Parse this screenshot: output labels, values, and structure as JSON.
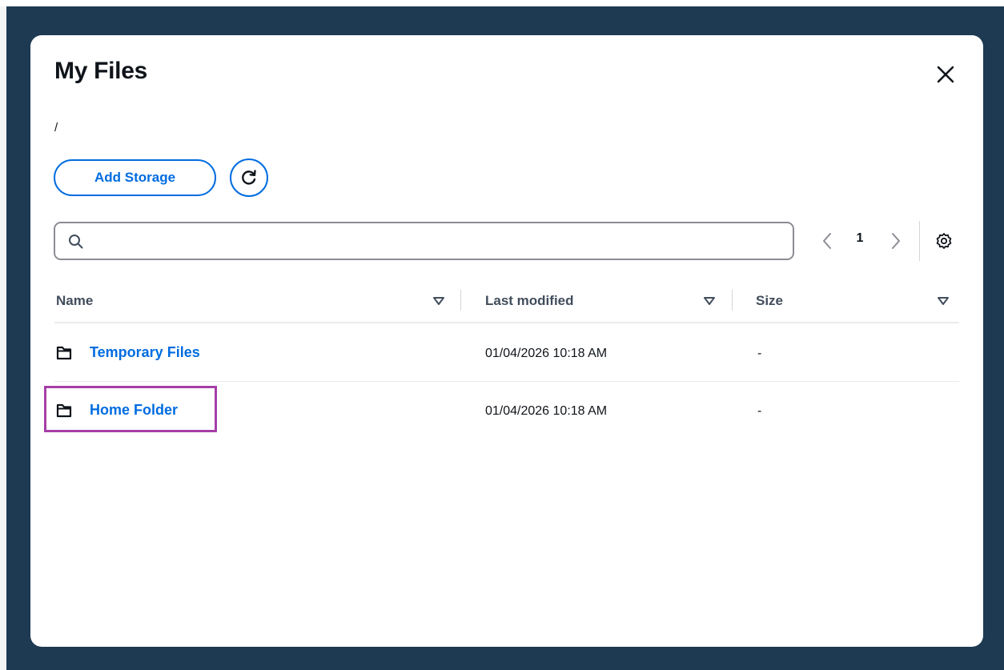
{
  "modal": {
    "title": "My Files",
    "breadcrumb": "/",
    "add_storage_label": "Add Storage",
    "search": {
      "placeholder": "",
      "value": ""
    },
    "pagination": {
      "current_page": "1"
    }
  },
  "table": {
    "columns": [
      "Name",
      "Last modified",
      "Size"
    ],
    "rows": [
      {
        "name": "Temporary Files",
        "last_modified": "01/04/2026 10:18 AM",
        "size": "-"
      },
      {
        "name": "Home Folder",
        "last_modified": "01/04/2026 10:18 AM",
        "size": "-"
      }
    ]
  },
  "colors": {
    "backdrop": "#1e3a52",
    "accent": "#006ce0",
    "highlight": "#a63ea8"
  },
  "icons": [
    "close-icon",
    "refresh-icon",
    "search-icon",
    "chevron-left-icon",
    "chevron-right-icon",
    "gear-icon",
    "sort-icon",
    "folder-icon"
  ]
}
